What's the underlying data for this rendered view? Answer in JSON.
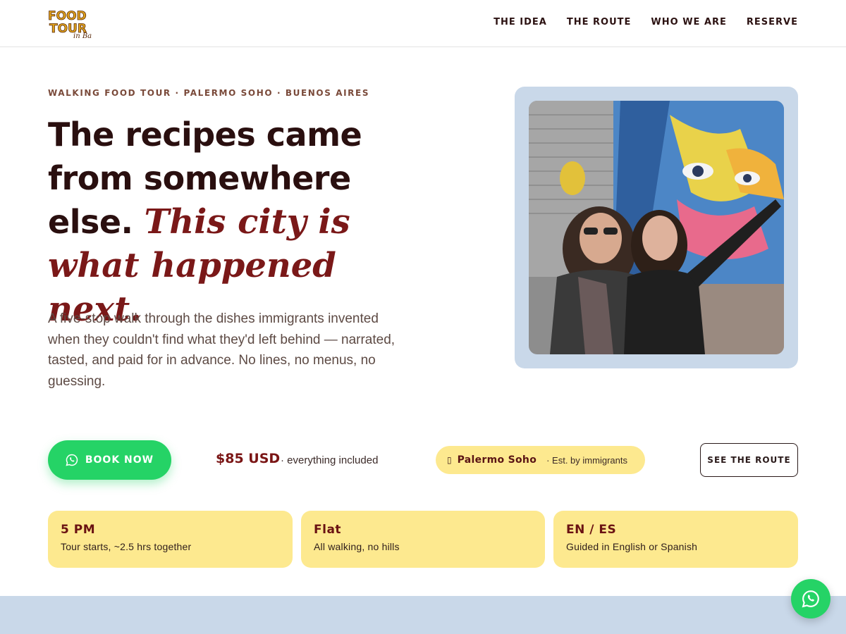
{
  "header": {
    "logo": {
      "line1": "FOOD",
      "line2": "TOUR",
      "line3": "in Ba"
    },
    "nav": [
      {
        "label": "THE IDEA"
      },
      {
        "label": "THE ROUTE"
      },
      {
        "label": "WHO WE ARE"
      },
      {
        "label": "RESERVE"
      }
    ]
  },
  "hero": {
    "eyebrow": "WALKING FOOD TOUR · PALERMO SOHO · BUENOS AIRES",
    "headline_plain": "The recipes came from somewhere else.",
    "headline_accent": "This city is what happened next.",
    "intro": "A five-stop walk through the dishes immigrants invented when they couldn't find what they'd left behind — narrated, tasted, and paid for in advance. No lines, no menus, no guessing.",
    "photo_icon": "selfie-photo-mural"
  },
  "cta": {
    "book_label": "BOOK NOW",
    "book_icon": "whatsapp-icon",
    "price": "$85 USD",
    "price_note": "· everything included",
    "location_icon": "pin-icon",
    "location": "Palermo Soho",
    "location_note": "· Est. by immigrants",
    "route_label": "SEE THE ROUTE"
  },
  "features": [
    {
      "title": "5 PM",
      "subtitle": "Tour starts, ~2.5 hrs together"
    },
    {
      "title": "Flat",
      "subtitle": "All walking, no hills"
    },
    {
      "title": "EN / ES",
      "subtitle": "Guided in English or Spanish"
    }
  ],
  "colors": {
    "accent": "#7a1818",
    "whatsapp": "#25d366",
    "card_yellow": "#fde98f",
    "band_blue": "#c9d8e9"
  }
}
